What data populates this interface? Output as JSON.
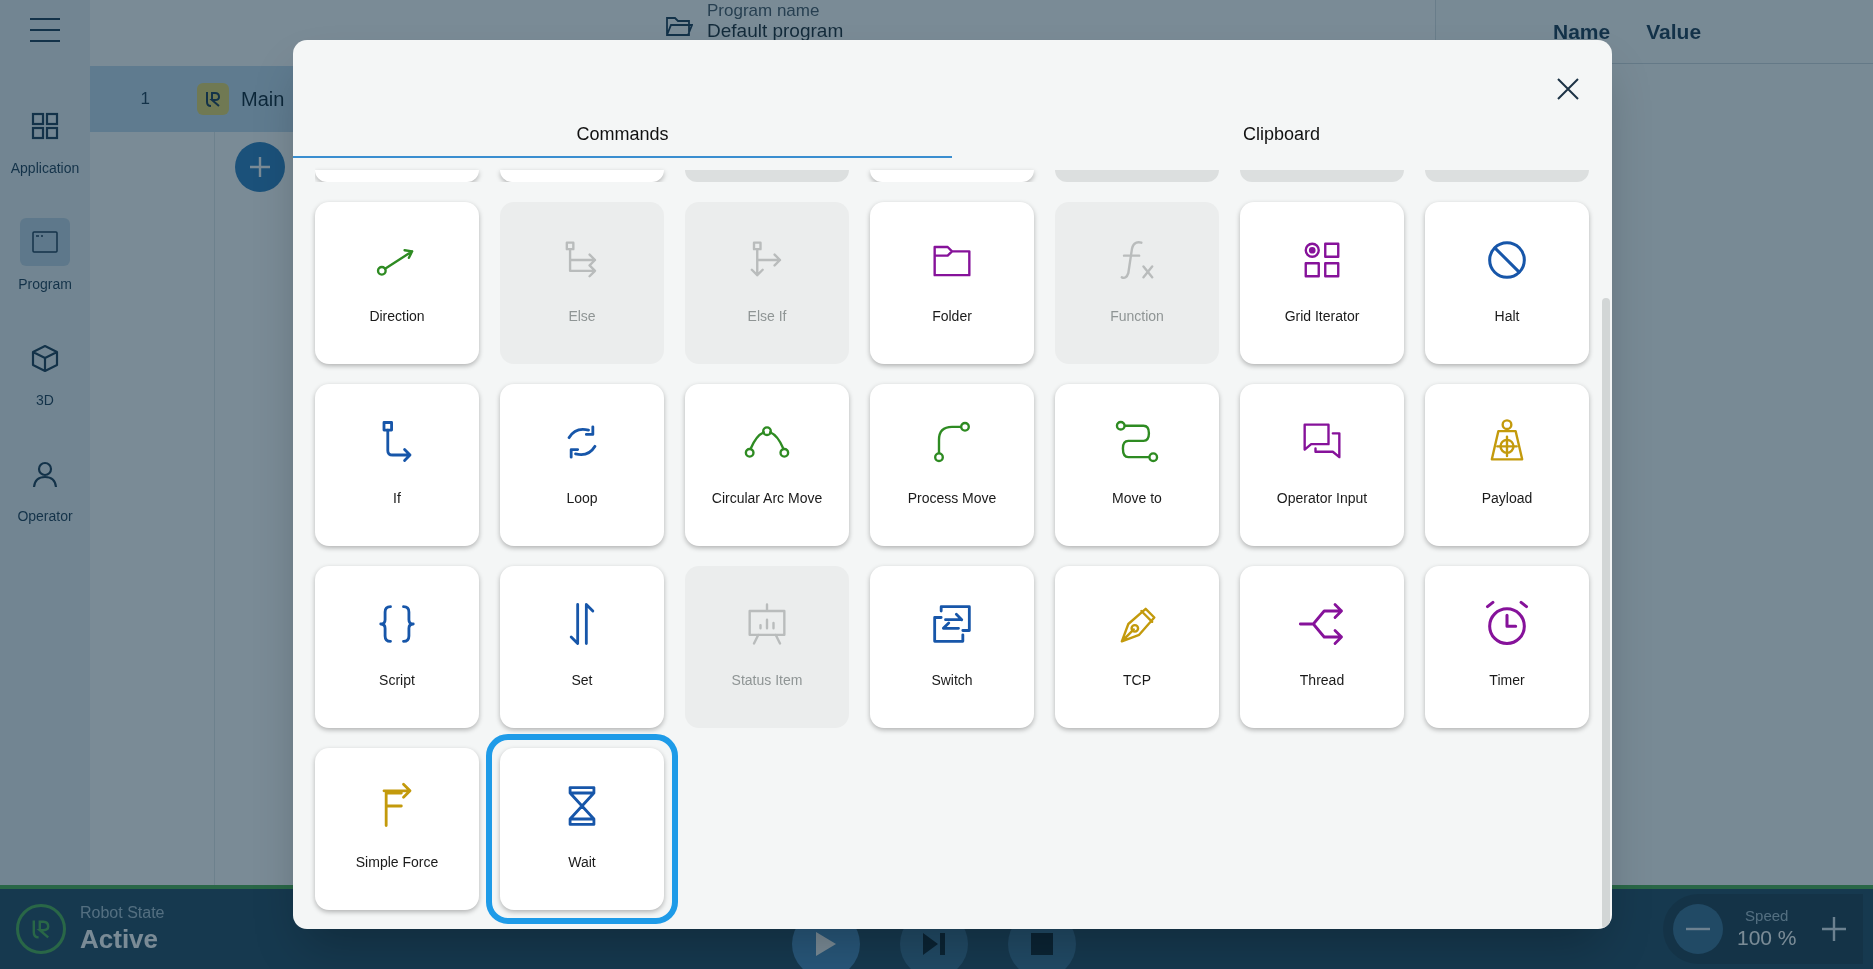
{
  "sidebar": {
    "items": [
      {
        "label": "Application",
        "selected": false
      },
      {
        "label": "Program",
        "selected": true
      },
      {
        "label": "3D",
        "selected": false
      },
      {
        "label": "Operator",
        "selected": false
      }
    ]
  },
  "header": {
    "program_label": "Program name",
    "program_name": "Default program"
  },
  "program_tree": {
    "rows": [
      {
        "number": "1",
        "label": "Main",
        "selected": true
      }
    ]
  },
  "variables_table": {
    "columns": [
      "Name",
      "Value"
    ]
  },
  "dialog": {
    "tabs": [
      {
        "label": "Commands",
        "selected": true
      },
      {
        "label": "Clipboard",
        "selected": false
      }
    ],
    "partial_row": [
      {
        "disabled": false
      },
      {
        "disabled": false
      },
      {
        "disabled": true
      },
      {
        "disabled": false
      },
      {
        "disabled": true
      },
      {
        "disabled": true
      },
      {
        "disabled": true
      }
    ],
    "commands": [
      {
        "label": "Direction",
        "disabled": false,
        "selected": false,
        "color": "#2e8b22"
      },
      {
        "label": "Else",
        "disabled": true,
        "selected": false
      },
      {
        "label": "Else If",
        "disabled": true,
        "selected": false
      },
      {
        "label": "Folder",
        "disabled": false,
        "selected": false,
        "color": "#86129a"
      },
      {
        "label": "Function",
        "disabled": true,
        "selected": false
      },
      {
        "label": "Grid Iterator",
        "disabled": false,
        "selected": false,
        "color": "#86129a"
      },
      {
        "label": "Halt",
        "disabled": false,
        "selected": false,
        "color": "#1756a9"
      },
      {
        "label": "If",
        "disabled": false,
        "selected": false,
        "color": "#1756a9"
      },
      {
        "label": "Loop",
        "disabled": false,
        "selected": false,
        "color": "#1756a9"
      },
      {
        "label": "Circular Arc Move",
        "disabled": false,
        "selected": false,
        "color": "#2e8b22"
      },
      {
        "label": "Process Move",
        "disabled": false,
        "selected": false,
        "color": "#2e8b22"
      },
      {
        "label": "Move to",
        "disabled": false,
        "selected": false,
        "color": "#2e8b22"
      },
      {
        "label": "Operator Input",
        "disabled": false,
        "selected": false,
        "color": "#86129a"
      },
      {
        "label": "Payload",
        "disabled": false,
        "selected": false,
        "color": "#c39a0c"
      },
      {
        "label": "Script",
        "disabled": false,
        "selected": false,
        "color": "#1756a9"
      },
      {
        "label": "Set",
        "disabled": false,
        "selected": false,
        "color": "#1756a9"
      },
      {
        "label": "Status Item",
        "disabled": true,
        "selected": false
      },
      {
        "label": "Switch",
        "disabled": false,
        "selected": false,
        "color": "#1756a9"
      },
      {
        "label": "TCP",
        "disabled": false,
        "selected": false,
        "color": "#c39a0c"
      },
      {
        "label": "Thread",
        "disabled": false,
        "selected": false,
        "color": "#86129a"
      },
      {
        "label": "Timer",
        "disabled": false,
        "selected": false,
        "color": "#86129a"
      },
      {
        "label": "Simple Force",
        "disabled": false,
        "selected": false,
        "color": "#c39a0c"
      },
      {
        "label": "Wait",
        "disabled": false,
        "selected": true,
        "color": "#1756a9"
      }
    ]
  },
  "status_bar": {
    "state_label": "Robot State",
    "state_value": "Active",
    "speed_label": "Speed",
    "speed_value": "100 %"
  }
}
